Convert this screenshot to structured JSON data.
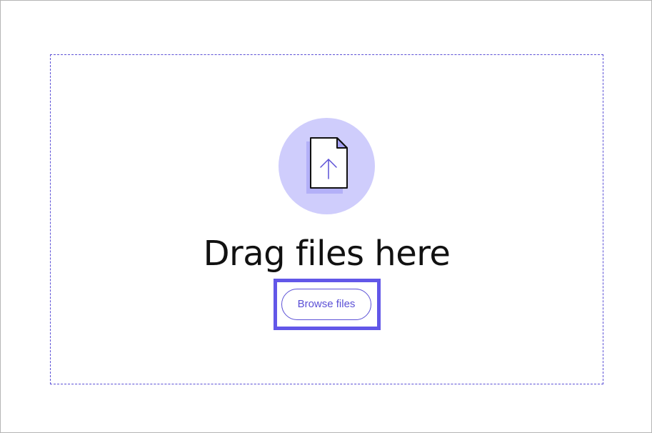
{
  "dropzone": {
    "title": "Drag files here",
    "icon": "file-upload-icon",
    "browse_label": "Browse files"
  },
  "colors": {
    "accent": "#5b50d6",
    "focus_ring": "#6257e8",
    "icon_circle": "#cfcdfc",
    "text": "#111111"
  }
}
